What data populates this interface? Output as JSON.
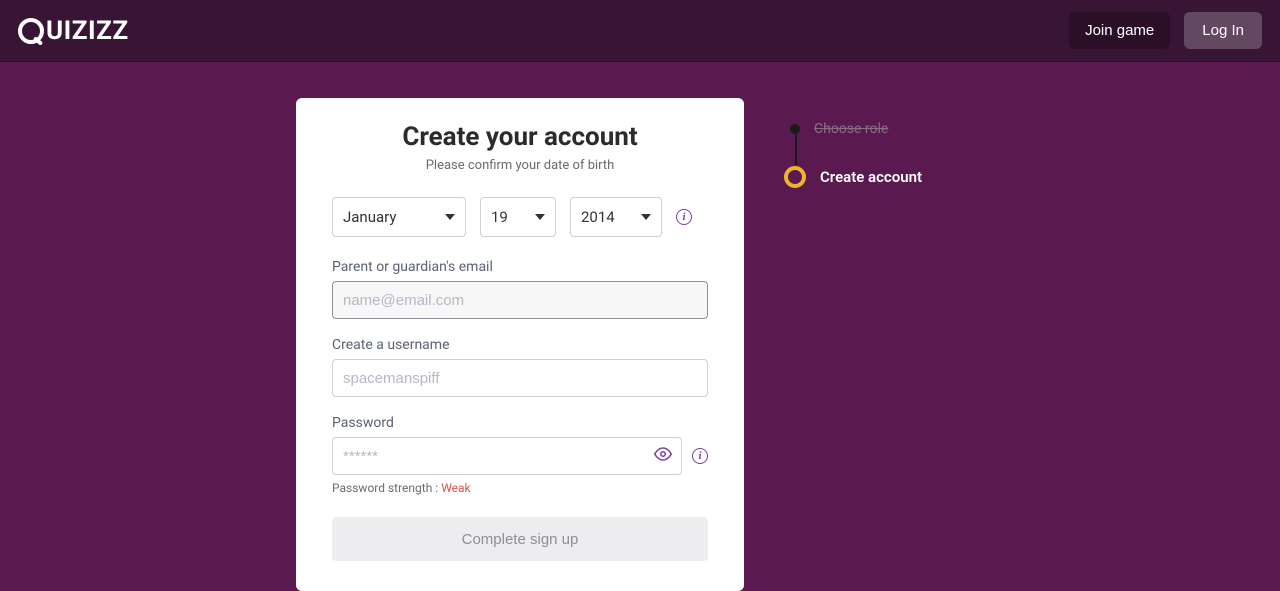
{
  "header": {
    "logo_text": "UIZIZZ",
    "join_label": "Join game",
    "login_label": "Log In"
  },
  "card": {
    "title": "Create your account",
    "subtitle": "Please confirm your date of birth",
    "dob": {
      "month": "January",
      "day": "19",
      "year": "2014"
    },
    "email_label": "Parent or guardian's email",
    "email_placeholder": "name@email.com",
    "username_label": "Create a username",
    "username_placeholder": "spacemanspiff",
    "password_label": "Password",
    "password_placeholder": "******",
    "password_strength_prefix": "Password strength : ",
    "password_strength_value": "Weak",
    "submit_label": "Complete sign up"
  },
  "stepper": {
    "step1": "Choose role",
    "step2": "Create account"
  }
}
